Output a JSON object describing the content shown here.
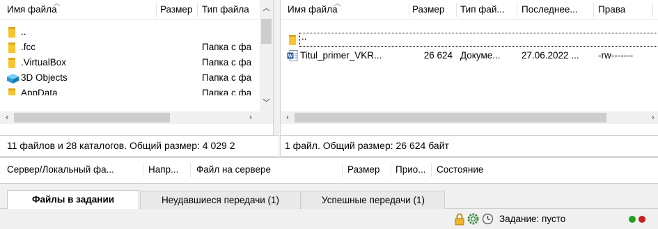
{
  "local_panel": {
    "headers": {
      "name": "Имя файла",
      "size": "Размер",
      "type": "Тип файла"
    },
    "rows": [
      {
        "name": "..",
        "type": ""
      },
      {
        "name": ".fcc",
        "type": "Папка с фа"
      },
      {
        "name": ".VirtualBox",
        "type": "Папка с фа"
      },
      {
        "name": "3D Objects",
        "type": "Папка с фа"
      },
      {
        "name": "AppData",
        "type": "Папка с фа"
      }
    ],
    "status": "11 файлов и 28 каталогов. Общий размер: 4 029 2"
  },
  "remote_panel": {
    "headers": {
      "name": "Имя файла",
      "size": "Размер",
      "type": "Тип фай...",
      "modified": "Последнее...",
      "perms": "Права"
    },
    "parent_row": "..",
    "file_row": {
      "name": "Titul_primer_VKR...",
      "size": "26 624",
      "type": "Докуме...",
      "modified": "27.06.2022 ...",
      "perms": "-rw-------"
    },
    "status": "1 файл. Общий размер: 26 624 байт"
  },
  "queue": {
    "headers": {
      "server": "Сервер/Локальный фа...",
      "direction": "Напр...",
      "remote_file": "Файл на сервере",
      "size": "Размер",
      "priority": "Прио...",
      "state": "Состояние"
    }
  },
  "tabs": {
    "queued": "Файлы в задании",
    "failed": "Неудавшиеся передачи (1)",
    "success": "Успешные передачи (1)"
  },
  "statusbar": {
    "queue_text": "Задание: пусто",
    "icons": [
      "lock-icon",
      "gear-icon",
      "clock-icon"
    ],
    "led_colors": {
      "send": "#1fa01f",
      "receive": "#c81e1e"
    }
  },
  "colors": {
    "selection_border": "#000000",
    "folder": "#f7c531"
  }
}
